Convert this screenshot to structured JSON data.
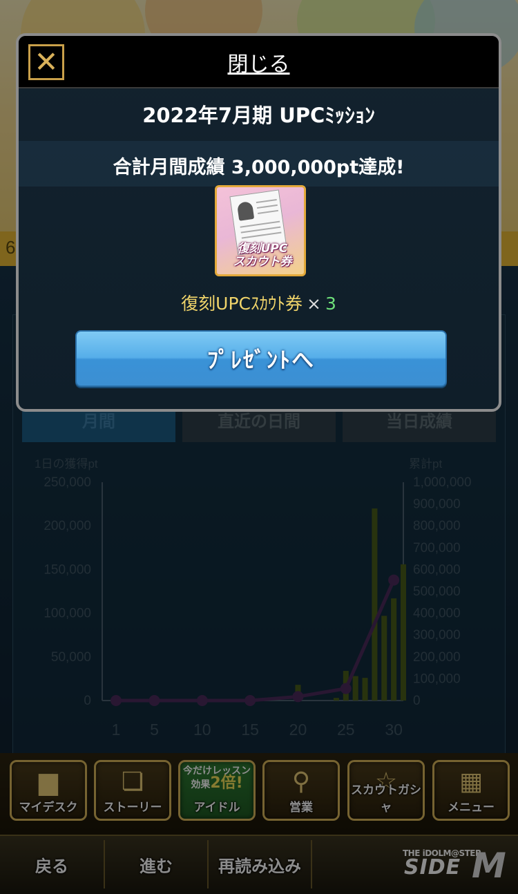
{
  "background": {
    "strip_fragment": "6",
    "tabs": [
      {
        "label": "月間",
        "active": true
      },
      {
        "label": "直近の日間",
        "active": false
      },
      {
        "label": "当日成績",
        "active": false
      }
    ]
  },
  "chart_data": {
    "type": "bar",
    "ylabel": "1日の獲得pt",
    "y2label": "累計pt",
    "ylim": [
      0,
      250000
    ],
    "y2lim": [
      0,
      1000000
    ],
    "yticks": [
      "250,000",
      "200,000",
      "150,000",
      "100,000",
      "50,000",
      "0"
    ],
    "y2ticks": [
      "1,000,000",
      "900,000",
      "800,000",
      "700,000",
      "600,000",
      "500,000",
      "400,000",
      "300,000",
      "200,000",
      "100,000",
      "0"
    ],
    "xticks": [
      "1",
      "5",
      "10",
      "15",
      "20",
      "25",
      "30"
    ],
    "xlim": [
      1,
      31
    ],
    "bars": [
      {
        "day": 20,
        "value": 18000
      },
      {
        "day": 24,
        "value": 3000
      },
      {
        "day": 25,
        "value": 34000
      },
      {
        "day": 26,
        "value": 28000
      },
      {
        "day": 27,
        "value": 26000
      },
      {
        "day": 28,
        "value": 220000
      },
      {
        "day": 29,
        "value": 97000
      },
      {
        "day": 30,
        "value": 117000
      },
      {
        "day": 31,
        "value": 156000
      }
    ],
    "cumulative": [
      {
        "day": 1,
        "value": 0
      },
      {
        "day": 5,
        "value": 0
      },
      {
        "day": 10,
        "value": 0
      },
      {
        "day": 15,
        "value": 0
      },
      {
        "day": 20,
        "value": 18000
      },
      {
        "day": 25,
        "value": 55000
      },
      {
        "day": 30,
        "value": 552000
      }
    ],
    "bar_color": "#4a5d1a",
    "line_color": "#4b2a5c"
  },
  "nav": [
    {
      "key": "mydesk",
      "label": "マイデスク",
      "icon": "sofa-icon",
      "glyph": "⛾"
    },
    {
      "key": "story",
      "label": "ストーリー",
      "icon": "book-icon",
      "glyph": "📖"
    },
    {
      "key": "idol",
      "label": "アイドル",
      "icon": "promo-badge",
      "promo_line1": "今だけレッスン",
      "promo_line2": "効果",
      "promo_bold": "2倍!"
    },
    {
      "key": "eigyo",
      "label": "営業",
      "icon": "microphone-icon",
      "glyph": "🎤"
    },
    {
      "key": "scout",
      "label": "スカウトガシャ",
      "icon": "star-icon",
      "glyph": "☆"
    },
    {
      "key": "menu",
      "label": "メニュー",
      "icon": "grid-icon",
      "glyph": "▦"
    }
  ],
  "footer": {
    "back": "戻る",
    "forward": "進む",
    "reload": "再読み込み",
    "logo_top": "THE iDOLM@STER",
    "logo_side": "SIDE",
    "logo_m": "M"
  },
  "modal": {
    "close_label": "閉じる",
    "title": "2022年7月期 UPCﾐｯｼｮﾝ",
    "achievement": "合計月間成績 3,000,000pt達成!",
    "ticket_label_line1": "復刻UPC",
    "ticket_label_line2": "スカウト券",
    "reward_name": "復刻UPCｽｶｳﾄ券",
    "reward_times": "×",
    "reward_qty": "3",
    "present_button": "ﾌﾟﾚｾﾞﾝﾄへ"
  }
}
